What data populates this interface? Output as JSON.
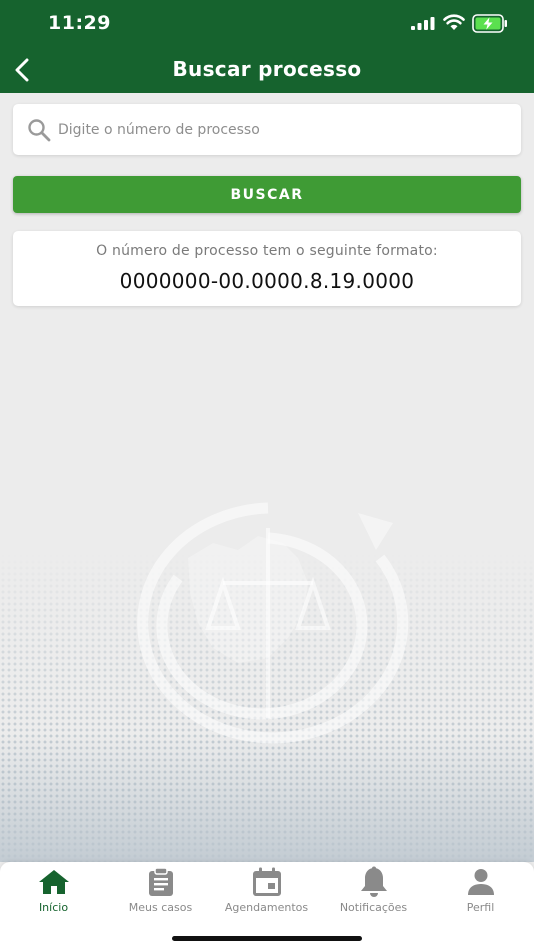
{
  "status_bar": {
    "time": "11:29"
  },
  "header": {
    "title": "Buscar processo"
  },
  "search": {
    "placeholder": "Digite o número de processo",
    "value": ""
  },
  "search_button": {
    "label": "BUSCAR"
  },
  "format_card": {
    "caption": "O número de processo tem o seguinte formato:",
    "pattern": "0000000-00.0000.8.19.0000"
  },
  "tabbar": {
    "items": [
      {
        "label": "Início",
        "icon": "home-icon",
        "active": true
      },
      {
        "label": "Meus casos",
        "icon": "clipboard-icon",
        "active": false
      },
      {
        "label": "Agendamentos",
        "icon": "calendar-icon",
        "active": false
      },
      {
        "label": "Notificações",
        "icon": "bell-icon",
        "active": false
      },
      {
        "label": "Perfil",
        "icon": "person-icon",
        "active": false
      }
    ]
  },
  "colors": {
    "header_green": "#16632e",
    "button_green": "#3f9b35",
    "active_tab": "#16632e",
    "inactive_tab": "#8a8a8a"
  }
}
